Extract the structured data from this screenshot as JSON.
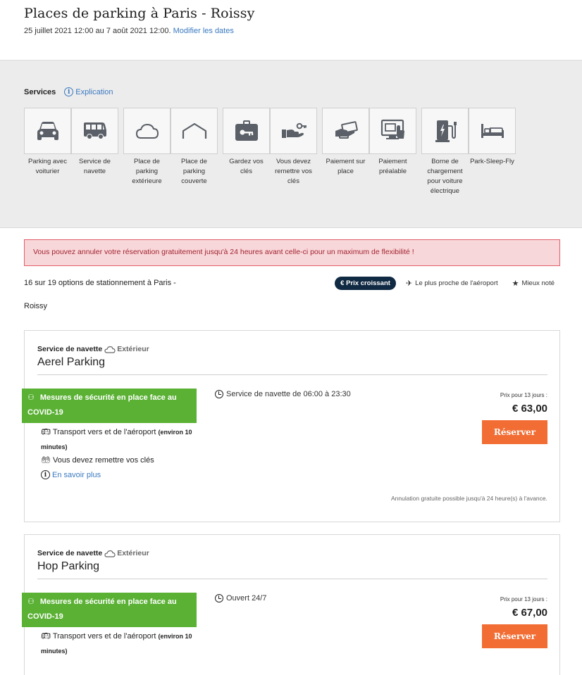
{
  "header": {
    "title": "Places de parking à Paris - Roissy",
    "dates": "25 juillet 2021 12:00 au 7 août 2021 12:00.",
    "modify_link": "Modifier les dates"
  },
  "services": {
    "label": "Services",
    "explanation": "Explication",
    "info_icon": "i",
    "items": [
      {
        "label": "Parking avec voiturier",
        "icon": "car-icon"
      },
      {
        "label": "Service de navette",
        "icon": "shuttle-bus-icon"
      },
      {
        "label": "Place de parking extérieure",
        "icon": "cloud-icon"
      },
      {
        "label": "Place de parking couverte",
        "icon": "roof-icon"
      },
      {
        "label": "Gardez vos clés",
        "icon": "key-case-icon"
      },
      {
        "label": "Vous devez remettre vos clés",
        "icon": "hand-key-icon"
      },
      {
        "label": "Paiement sur place",
        "icon": "cash-icon"
      },
      {
        "label": "Paiement préalable",
        "icon": "online-payment-icon"
      },
      {
        "label": "Borne de chargement pour voiture électrique",
        "icon": "ev-charger-icon"
      },
      {
        "label": "Park-Sleep-Fly",
        "icon": "bed-icon"
      }
    ]
  },
  "alert": "Vous pouvez annuler votre réservation gratuitement jusqu'à 24 heures avant celle-ci pour un maximum de flexibilité !",
  "results": {
    "count_line1": "16 sur 19 options de stationnement à Paris -",
    "count_line2": "Roissy",
    "sort_options": [
      {
        "label": "Prix croissant",
        "glyph": "€",
        "active": true
      },
      {
        "label": "Le plus proche de l'aéroport",
        "glyph": "✈",
        "active": false
      },
      {
        "label": "Mieux noté",
        "glyph": "★",
        "active": false
      }
    ]
  },
  "listings": [
    {
      "type": "Service de navette",
      "location": "Extérieur",
      "name": "Aerel Parking",
      "covid": "Mesures de sécurité en place face au COVID-19",
      "transport": "Transport vers et de l'aéroport",
      "transport_note": "(environ 10 minutes)",
      "keys": "Vous devez remettre vos clés",
      "more": "En savoir plus",
      "hours": "Service de navette de 06:00 à 23:30",
      "price_label": "Prix pour 13 jours :",
      "price": "€ 63,00",
      "reserve": "Réserver",
      "cancellation": "Annulation gratuite possible jusqu'à 24 heure(s) à l'avance."
    },
    {
      "type": "Service de navette",
      "location": "Extérieur",
      "name": "Hop Parking",
      "covid": "Mesures de sécurité en place face au COVID-19",
      "transport": "Transport vers et de l'aéroport",
      "transport_note": "(environ 10 minutes)",
      "hours": "Ouvert 24/7",
      "price_label": "Prix pour 13 jours :",
      "price": "€ 67,00",
      "reserve": "Réserver"
    }
  ]
}
